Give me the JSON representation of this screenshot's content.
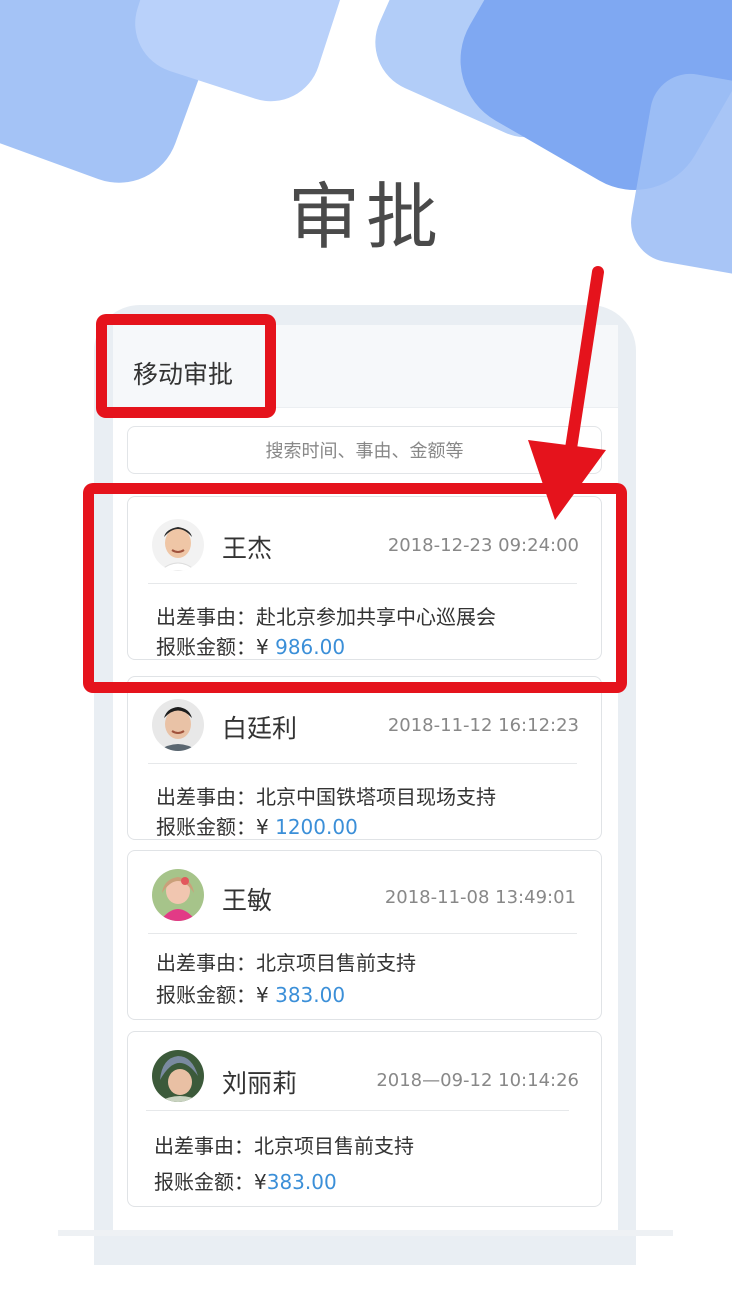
{
  "hero_title": "审批",
  "screen_title": "移动审批",
  "search": {
    "placeholder": "搜索时间、事由、金额等"
  },
  "labels": {
    "reason_prefix": "出差事由：",
    "amount_prefix": "报账金额："
  },
  "records": [
    {
      "name": "王杰",
      "time": "2018-12-23 09:24:00",
      "reason": "赴北京参加共享中心巡展会",
      "currency": "¥ ",
      "amount": "986.00"
    },
    {
      "name": "白廷利",
      "time": "2018-11-12 16:12:23",
      "reason": "北京中国铁塔项目现场支持",
      "currency": "¥ ",
      "amount": "1200.00"
    },
    {
      "name": "王敏",
      "time": "2018-11-08 13:49:01",
      "reason": "北京项目售前支持",
      "currency": "¥ ",
      "amount": "383.00"
    },
    {
      "name": "刘丽莉",
      "time": "2018—09-12 10:14:26",
      "reason": "北京项目售前支持",
      "currency": "¥",
      "amount": "383.00"
    }
  ],
  "colors": {
    "highlight": "#e5131c",
    "amount": "#3b8fd8",
    "blob_blue": "#7fa8f2"
  }
}
